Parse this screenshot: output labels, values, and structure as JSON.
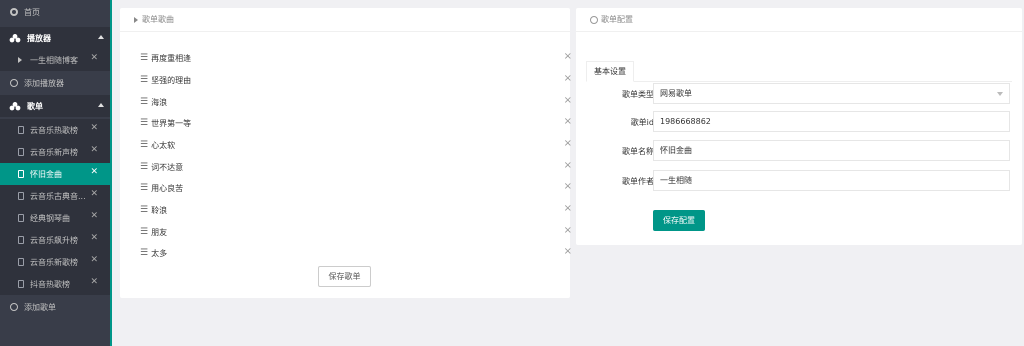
{
  "sidebar": {
    "home": "首页",
    "player_section": "播放器",
    "player_items": [
      "一生相随博客"
    ],
    "add_player": "添加播放器",
    "playlist_section": "歌单",
    "playlists": [
      "云音乐热歌榜",
      "云音乐新声榜",
      "怀旧金曲",
      "云音乐古典音...",
      "经典钢琴曲",
      "云音乐飙升榜",
      "云音乐新歌榜",
      "抖音热歌榜"
    ],
    "add_playlist": "添加歌单",
    "accent_color": "#009688"
  },
  "songs_panel": {
    "title": "歌单歌曲",
    "songs": [
      "再度重相逢",
      "坚强的理由",
      "海浪",
      "世界第一等",
      "心太软",
      "词不达意",
      "用心良苦",
      "聆浪",
      "朋友",
      "太多"
    ],
    "drag_icon": "☰",
    "delete_icon": "×",
    "save_label": "保存歌单"
  },
  "config_panel": {
    "title": "歌单配置",
    "tab": "基本设置",
    "fields": [
      {
        "label": "歌单类型",
        "value": "网易歌单"
      },
      {
        "label": "歌单id",
        "value": "1986668862"
      },
      {
        "label": "歌单名称",
        "value": "怀旧金曲"
      },
      {
        "label": "歌单作者",
        "value": "一生相随"
      }
    ],
    "save_label": "保存配置"
  }
}
